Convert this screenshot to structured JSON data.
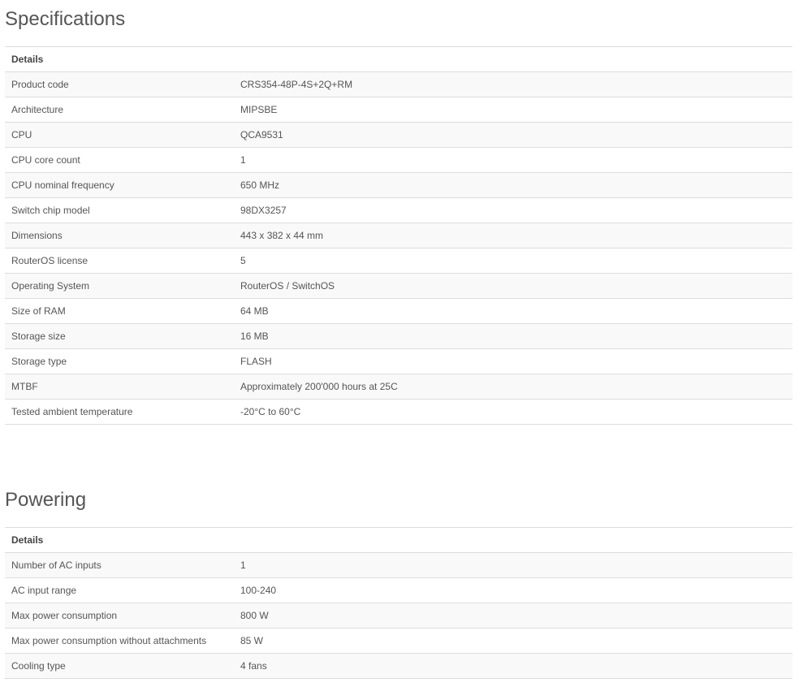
{
  "specifications": {
    "title": "Specifications",
    "header": "Details",
    "rows": [
      {
        "label": "Product code",
        "value": "CRS354-48P-4S+2Q+RM"
      },
      {
        "label": "Architecture",
        "value": "MIPSBE"
      },
      {
        "label": "CPU",
        "value": "QCA9531"
      },
      {
        "label": "CPU core count",
        "value": "1"
      },
      {
        "label": "CPU nominal frequency",
        "value": "650 MHz"
      },
      {
        "label": "Switch chip model",
        "value": "98DX3257"
      },
      {
        "label": "Dimensions",
        "value": "443 x 382 x 44 mm"
      },
      {
        "label": "RouterOS license",
        "value": "5"
      },
      {
        "label": "Operating System",
        "value": "RouterOS / SwitchOS"
      },
      {
        "label": "Size of RAM",
        "value": "64 MB"
      },
      {
        "label": "Storage size",
        "value": "16 MB"
      },
      {
        "label": "Storage type",
        "value": "FLASH"
      },
      {
        "label": "MTBF",
        "value": "Approximately 200'000 hours at 25C"
      },
      {
        "label": "Tested ambient temperature",
        "value": "-20°C to 60°C"
      }
    ]
  },
  "powering": {
    "title": "Powering",
    "header": "Details",
    "rows": [
      {
        "label": "Number of AC inputs",
        "value": "1"
      },
      {
        "label": "AC input range",
        "value": "100-240"
      },
      {
        "label": "Max power consumption",
        "value": "800 W"
      },
      {
        "label": "Max power consumption without attachments",
        "value": "85 W"
      },
      {
        "label": "Cooling type",
        "value": "4 fans"
      }
    ]
  }
}
